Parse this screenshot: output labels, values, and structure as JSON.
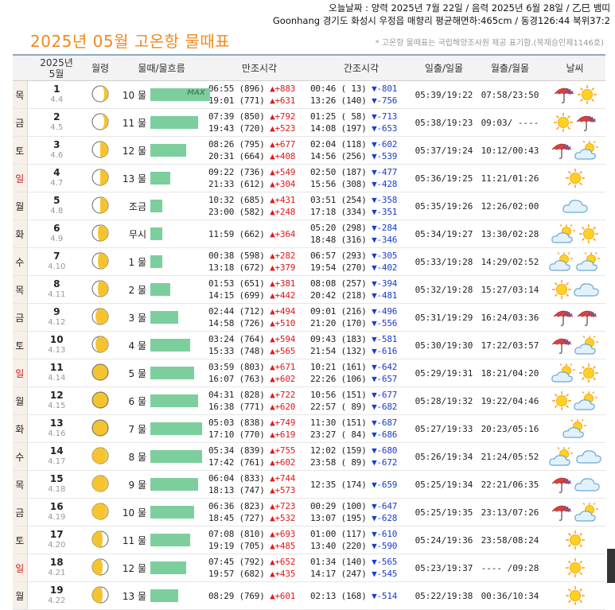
{
  "top_info": {
    "line1": "오늘날짜 : 양력 2025년 7월 22일 / 음력 2025년 6월 28일 / 乙巳 뱀띠",
    "line2": "Goonhang 경기도 화성시 우정읍 매향리 평균해면하:465cm / 동경126:44 북위37:2"
  },
  "page_title": "2025년 05월 고온항 물때표",
  "note": "* 고온항 물때표는 국립해양조사원 제공 표기함.(복제승인제1146호)",
  "columns": {
    "date": [
      "2025년",
      "5월"
    ],
    "moon": "월령",
    "mul": "물때/물흐름",
    "high": "만조시각",
    "low": "간조시각",
    "sun": "일출/일몰",
    "moonrise": "월출/월몰",
    "weather": "날씨"
  },
  "rows": [
    {
      "dow": "목",
      "sun": false,
      "day": "1",
      "lunar": "4.4",
      "moon": "cres",
      "mul": "10 물",
      "bar": 100,
      "max": "MAX",
      "high": [
        "06:55 (896) ",
        "▲+883",
        "19:01 (771) ",
        "▲+631"
      ],
      "low": [
        "00:46 ( 13) ",
        "▼-801",
        "13:26 (140) ",
        "▼-756"
      ],
      "sunrs": "05:39/19:22",
      "moonrs": "07:58/23:50",
      "wx": [
        "rain",
        "sun"
      ]
    },
    {
      "dow": "금",
      "sun": false,
      "day": "2",
      "lunar": "4.5",
      "moon": "cres",
      "mul": "11 물",
      "bar": 80,
      "max": "",
      "high": [
        "07:39 (850) ",
        "▲+792",
        "19:43 (720) ",
        "▲+523"
      ],
      "low": [
        "01:25 ( 58) ",
        "▼-713",
        "14:08 (197) ",
        "▼-653"
      ],
      "sunrs": "05:38/19:23",
      "moonrs": "09:03/ ----",
      "wx": [
        "sun",
        "rain"
      ]
    },
    {
      "dow": "토",
      "sun": false,
      "day": "3",
      "lunar": "4.6",
      "moon": "quarter",
      "mul": "12 물",
      "bar": 60,
      "max": "",
      "high": [
        "08:26 (795) ",
        "▲+677",
        "20:31 (664) ",
        "▲+408"
      ],
      "low": [
        "02:04 (118) ",
        "▼-602",
        "14:56 (256) ",
        "▼-539"
      ],
      "sunrs": "05:37/19:24",
      "moonrs": "10:12/00:43",
      "wx": [
        "rain",
        "suncloud"
      ]
    },
    {
      "dow": "일",
      "sun": true,
      "day": "4",
      "lunar": "4.7",
      "moon": "quarter",
      "mul": "13 물",
      "bar": 33,
      "max": "",
      "high": [
        "09:22 (736) ",
        "▲+549",
        "21:33 (612) ",
        "▲+304"
      ],
      "low": [
        "02:50 (187) ",
        "▼-477",
        "15:56 (308) ",
        "▼-428"
      ],
      "sunrs": "05:36/19:25",
      "moonrs": "11:21/01:26",
      "wx": [
        "sun"
      ]
    },
    {
      "dow": "월",
      "sun": false,
      "day": "5",
      "lunar": "4.8",
      "moon": "quarter",
      "mul": "조금",
      "bar": 20,
      "max": "",
      "high": [
        "10:32 (685) ",
        "▲+431",
        "23:00 (582) ",
        "▲+248"
      ],
      "low": [
        "03:51 (254) ",
        "▼-358",
        "17:18 (334) ",
        "▼-351"
      ],
      "sunrs": "05:35/19:26",
      "moonrs": "12:26/02:00",
      "wx": [
        "cloud"
      ]
    },
    {
      "dow": "화",
      "sun": false,
      "day": "6",
      "lunar": "4.9",
      "moon": "gib1",
      "mul": "무시",
      "bar": 20,
      "max": "",
      "high": [
        "11:59 (662) ",
        "▲+364",
        "",
        ""
      ],
      "low": [
        "05:20 (298) ",
        "▼-284",
        "18:48 (316) ",
        "▼-346"
      ],
      "sunrs": "05:34/19:27",
      "moonrs": "13:30/02:28",
      "wx": [
        "suncloud",
        "sun"
      ]
    },
    {
      "dow": "수",
      "sun": false,
      "day": "7",
      "lunar": "4.10",
      "moon": "gib1",
      "mul": "1 물",
      "bar": 20,
      "max": "",
      "high": [
        "00:38 (598) ",
        "▲+282",
        "13:18 (672) ",
        "▲+379"
      ],
      "low": [
        "06:57 (293) ",
        "▼-305",
        "19:54 (270) ",
        "▼-402"
      ],
      "sunrs": "05:33/19:28",
      "moonrs": "14:29/02:52",
      "wx": [
        "suncloud",
        "suncloud"
      ]
    },
    {
      "dow": "목",
      "sun": false,
      "day": "8",
      "lunar": "4.11",
      "moon": "gib1",
      "mul": "2 물",
      "bar": 33,
      "max": "",
      "high": [
        "01:53 (651) ",
        "▲+381",
        "14:15 (699) ",
        "▲+442"
      ],
      "low": [
        "08:08 (257) ",
        "▼-394",
        "20:42 (218) ",
        "▼-481"
      ],
      "sunrs": "05:32/19:28",
      "moonrs": "15:27/03:14",
      "wx": [
        "sun",
        "cloud"
      ]
    },
    {
      "dow": "금",
      "sun": false,
      "day": "9",
      "lunar": "4.12",
      "moon": "gib2",
      "mul": "3 물",
      "bar": 47,
      "max": "",
      "high": [
        "02:44 (712) ",
        "▲+494",
        "14:58 (726) ",
        "▲+510"
      ],
      "low": [
        "09:01 (216) ",
        "▼-496",
        "21:20 (170) ",
        "▼-556"
      ],
      "sunrs": "05:31/19:29",
      "moonrs": "16:24/03:36",
      "wx": [
        "rain",
        "rain"
      ]
    },
    {
      "dow": "토",
      "sun": false,
      "day": "10",
      "lunar": "4.13",
      "moon": "gib2",
      "mul": "4 물",
      "bar": 67,
      "max": "",
      "high": [
        "03:24 (764) ",
        "▲+594",
        "15:33 (748) ",
        "▲+565"
      ],
      "low": [
        "09:43 (183) ",
        "▼-581",
        "21:54 (132) ",
        "▼-616"
      ],
      "sunrs": "05:30/19:30",
      "moonrs": "17:22/03:57",
      "wx": [
        "rain",
        "suncloud"
      ]
    },
    {
      "dow": "일",
      "sun": true,
      "day": "11",
      "lunar": "4.14",
      "moon": "full",
      "mul": "5 물",
      "bar": 73,
      "max": "",
      "high": [
        "03:59 (803) ",
        "▲+671",
        "16:07 (763) ",
        "▲+602"
      ],
      "low": [
        "10:21 (161) ",
        "▼-642",
        "22:26 (106) ",
        "▼-657"
      ],
      "sunrs": "05:29/19:31",
      "moonrs": "18:21/04:20",
      "wx": [
        "suncloud",
        "sun"
      ]
    },
    {
      "dow": "월",
      "sun": false,
      "day": "12",
      "lunar": "4.15",
      "moon": "full",
      "mul": "6 물",
      "bar": 80,
      "max": "",
      "high": [
        "04:31 (828) ",
        "▲+722",
        "16:38 (771) ",
        "▲+620"
      ],
      "low": [
        "10:56 (151) ",
        "▼-677",
        "22:57 ( 89) ",
        "▼-682"
      ],
      "sunrs": "05:28/19:32",
      "moonrs": "19:22/04:46",
      "wx": [
        "sun",
        "suncloud"
      ]
    },
    {
      "dow": "화",
      "sun": false,
      "day": "13",
      "lunar": "4.16",
      "moon": "full",
      "mul": "7 물",
      "bar": 87,
      "max": "",
      "high": [
        "05:03 (838) ",
        "▲+749",
        "17:10 (770) ",
        "▲+619"
      ],
      "low": [
        "11:30 (151) ",
        "▼-687",
        "23:27 ( 84) ",
        "▼-686"
      ],
      "sunrs": "05:27/19:33",
      "moonrs": "20:23/05:16",
      "wx": [
        "suncloud"
      ]
    },
    {
      "dow": "수",
      "sun": false,
      "day": "14",
      "lunar": "4.17",
      "moon": "wan1",
      "mul": "8 물",
      "bar": 87,
      "max": "",
      "high": [
        "05:34 (839) ",
        "▲+755",
        "17:42 (761) ",
        "▲+602"
      ],
      "low": [
        "12:02 (159) ",
        "▼-680",
        "23:58 ( 89) ",
        "▼-672"
      ],
      "sunrs": "05:26/19:34",
      "moonrs": "21:24/05:52",
      "wx": [
        "suncloud",
        "cloud"
      ]
    },
    {
      "dow": "목",
      "sun": false,
      "day": "15",
      "lunar": "4.18",
      "moon": "wan1",
      "mul": "9 물",
      "bar": 80,
      "max": "",
      "high": [
        "06:04 (833) ",
        "▲+744",
        "18:13 (747) ",
        "▲+573"
      ],
      "low": [
        "12:35 (174) ",
        "▼-659",
        "",
        ""
      ],
      "sunrs": "05:25/19:34",
      "moonrs": "22:21/06:35",
      "wx": [
        "rain",
        "cloud"
      ]
    },
    {
      "dow": "금",
      "sun": false,
      "day": "16",
      "lunar": "4.19",
      "moon": "wan1",
      "mul": "10 물",
      "bar": 73,
      "max": "",
      "high": [
        "06:36 (823) ",
        "▲+723",
        "18:45 (727) ",
        "▲+532"
      ],
      "low": [
        "00:29 (100) ",
        "▼-647",
        "13:07 (195) ",
        "▼-628"
      ],
      "sunrs": "05:25/19:35",
      "moonrs": "23:13/07:26",
      "wx": [
        "rain",
        "suncloud"
      ]
    },
    {
      "dow": "토",
      "sun": false,
      "day": "17",
      "lunar": "4.20",
      "moon": "wan2",
      "mul": "11 물",
      "bar": 67,
      "max": "",
      "high": [
        "07:08 (810) ",
        "▲+693",
        "19:19 (705) ",
        "▲+485"
      ],
      "low": [
        "01:00 (117) ",
        "▼-610",
        "13:40 (220) ",
        "▼-590"
      ],
      "sunrs": "05:24/19:36",
      "moonrs": "23:58/08:24",
      "wx": [
        "sun"
      ]
    },
    {
      "dow": "일",
      "sun": true,
      "day": "18",
      "lunar": "4.21",
      "moon": "wan2",
      "mul": "12 물",
      "bar": 60,
      "max": "",
      "high": [
        "07:45 (792) ",
        "▲+652",
        "19:57 (682) ",
        "▲+435"
      ],
      "low": [
        "01:34 (140) ",
        "▼-565",
        "14:17 (247) ",
        "▼-545"
      ],
      "sunrs": "05:23/19:37",
      "moonrs": "---- /09:28",
      "wx": [
        "sun"
      ]
    },
    {
      "dow": "월",
      "sun": false,
      "day": "19",
      "lunar": "4.22",
      "moon": "wan2",
      "mul": "13 물",
      "bar": 47,
      "max": "",
      "high": [
        "08:29 (769) ",
        "▲+601",
        "",
        ""
      ],
      "low": [
        "02:13 (168) ",
        "▼-514",
        "",
        ""
      ],
      "sunrs": "05:22/19:38",
      "moonrs": "00:36/10:34",
      "wx": [
        "sun"
      ]
    }
  ]
}
